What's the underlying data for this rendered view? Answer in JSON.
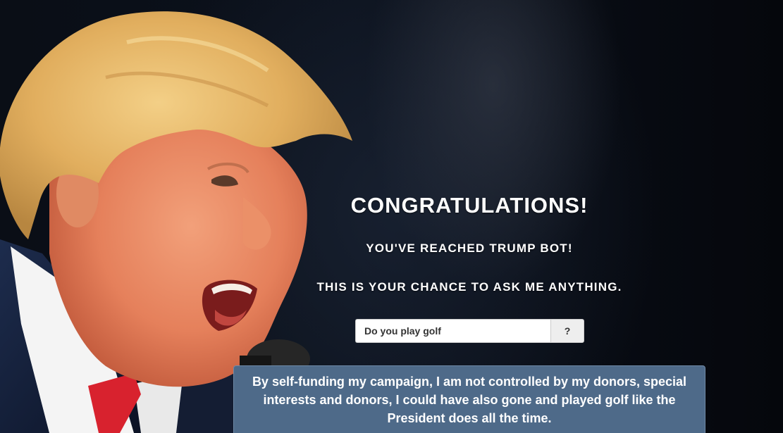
{
  "page": {
    "headline": "CONGRATULATIONS!",
    "intro": "YOU'VE REACHED TRUMP BOT!",
    "prompt": "THIS IS YOUR CHANCE TO ASK ME ANYTHING."
  },
  "ask": {
    "input_value": "Do you play golf",
    "button_label": "?"
  },
  "answer": {
    "text": "By self-funding my campaign, I am not controlled by my donors, special interests and donors, I could have also gone and played golf like the President does all the time."
  },
  "colors": {
    "background": "#05070c",
    "answer_box": "#4e6a89",
    "text": "#ffffff"
  },
  "background_image": "portrait-photo"
}
